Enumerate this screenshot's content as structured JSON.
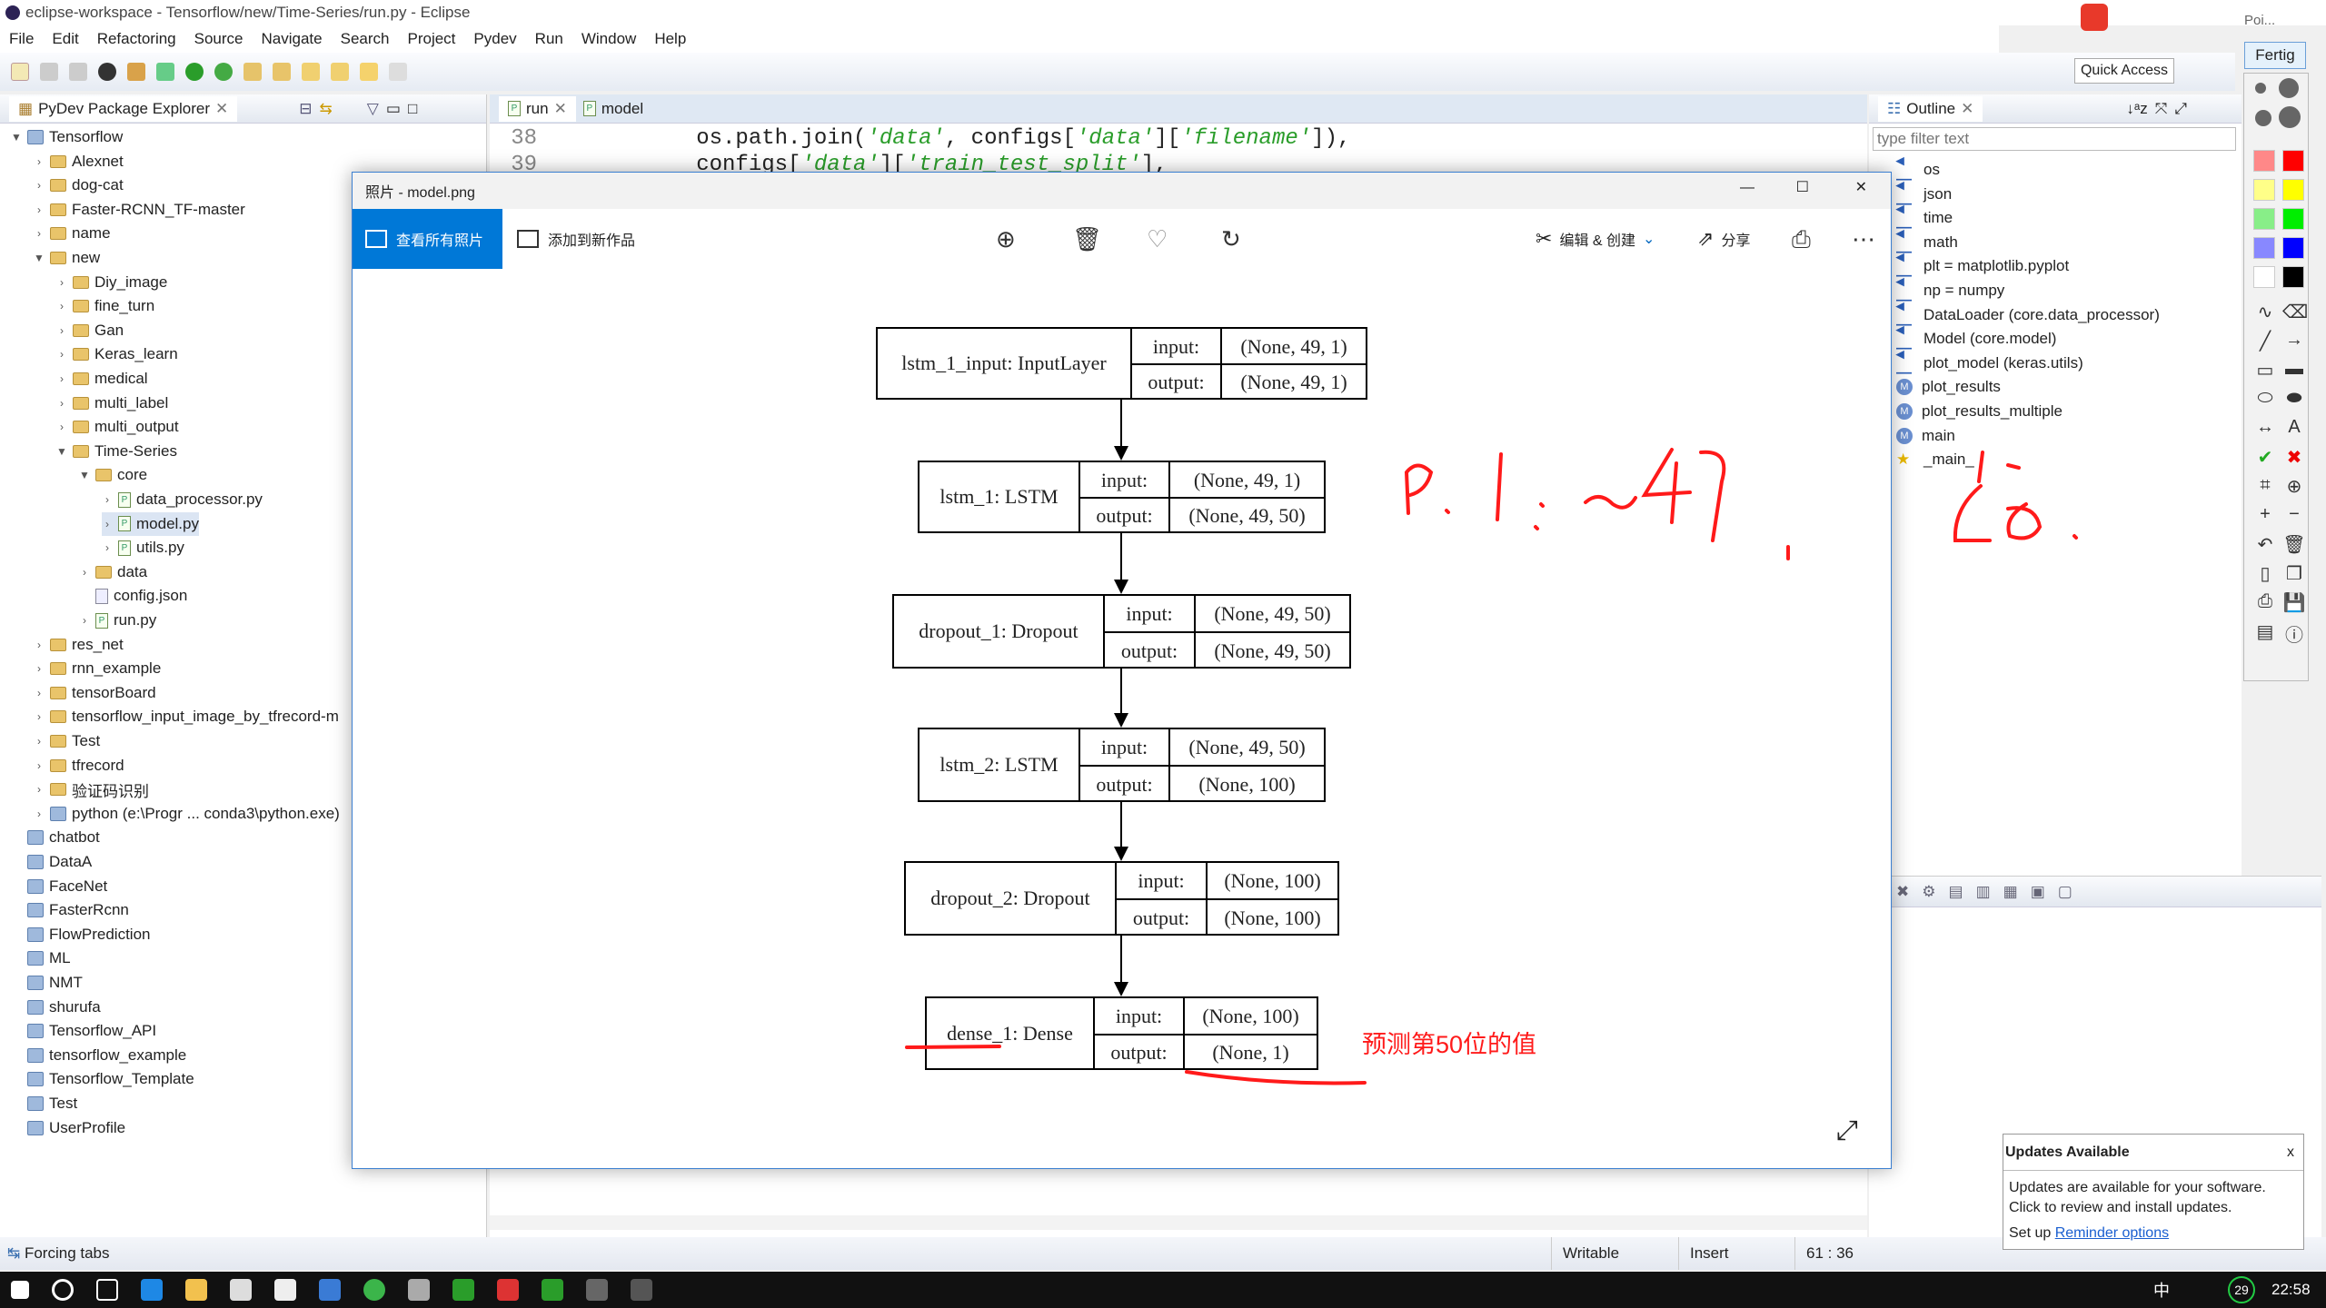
{
  "window": {
    "title": "eclipse-workspace - Tensorflow/new/Time-Series/run.py - Eclipse"
  },
  "menu": [
    "File",
    "Edit",
    "Refactoring",
    "Source",
    "Navigate",
    "Search",
    "Project",
    "Pydev",
    "Run",
    "Window",
    "Help"
  ],
  "quick_access": "Quick Access",
  "fertig": "Fertig",
  "explorer": {
    "title": "PyDev Package Explorer",
    "items": [
      {
        "label": "Tensorflow",
        "level": 0,
        "type": "project",
        "state": "open"
      },
      {
        "label": "Alexnet",
        "level": 1,
        "type": "folder",
        "state": "closed"
      },
      {
        "label": "dog-cat",
        "level": 1,
        "type": "folder",
        "state": "closed"
      },
      {
        "label": "Faster-RCNN_TF-master",
        "level": 1,
        "type": "folder",
        "state": "closed"
      },
      {
        "label": "name",
        "level": 1,
        "type": "folder",
        "state": "closed"
      },
      {
        "label": "new",
        "level": 1,
        "type": "folder",
        "state": "open"
      },
      {
        "label": "Diy_image",
        "level": 2,
        "type": "folder",
        "state": "closed"
      },
      {
        "label": "fine_turn",
        "level": 2,
        "type": "folder",
        "state": "closed"
      },
      {
        "label": "Gan",
        "level": 2,
        "type": "folder",
        "state": "closed"
      },
      {
        "label": "Keras_learn",
        "level": 2,
        "type": "folder",
        "state": "closed"
      },
      {
        "label": "medical",
        "level": 2,
        "type": "folder",
        "state": "closed"
      },
      {
        "label": "multi_label",
        "level": 2,
        "type": "folder",
        "state": "closed"
      },
      {
        "label": "multi_output",
        "level": 2,
        "type": "folder",
        "state": "closed"
      },
      {
        "label": "Time-Series",
        "level": 2,
        "type": "folder",
        "state": "open"
      },
      {
        "label": "core",
        "level": 3,
        "type": "folder",
        "state": "open"
      },
      {
        "label": "data_processor.py",
        "level": 4,
        "type": "py",
        "state": "closed"
      },
      {
        "label": "model.py",
        "level": 4,
        "type": "py",
        "state": "closed",
        "selected": true
      },
      {
        "label": "utils.py",
        "level": 4,
        "type": "py",
        "state": "closed"
      },
      {
        "label": "data",
        "level": 3,
        "type": "folder",
        "state": "closed"
      },
      {
        "label": "config.json",
        "level": 3,
        "type": "json",
        "state": "none"
      },
      {
        "label": "run.py",
        "level": 3,
        "type": "py",
        "state": "closed"
      },
      {
        "label": "res_net",
        "level": 1,
        "type": "folder",
        "state": "closed"
      },
      {
        "label": "rnn_example",
        "level": 1,
        "type": "folder",
        "state": "closed"
      },
      {
        "label": "tensorBoard",
        "level": 1,
        "type": "folder",
        "state": "closed"
      },
      {
        "label": "tensorflow_input_image_by_tfrecord-m",
        "level": 1,
        "type": "folder",
        "state": "closed"
      },
      {
        "label": "Test",
        "level": 1,
        "type": "folder",
        "state": "closed"
      },
      {
        "label": "tfrecord",
        "level": 1,
        "type": "folder",
        "state": "closed"
      },
      {
        "label": "验证码识别",
        "level": 1,
        "type": "folder",
        "state": "closed"
      },
      {
        "label": "python  (e:\\Progr ... conda3\\python.exe)",
        "level": 1,
        "type": "python",
        "state": "closed"
      },
      {
        "label": "chatbot",
        "level": 0,
        "type": "project",
        "state": "none"
      },
      {
        "label": "DataA",
        "level": 0,
        "type": "project",
        "state": "none"
      },
      {
        "label": "FaceNet",
        "level": 0,
        "type": "project",
        "state": "none"
      },
      {
        "label": "FasterRcnn",
        "level": 0,
        "type": "project",
        "state": "none"
      },
      {
        "label": "FlowPrediction",
        "level": 0,
        "type": "project",
        "state": "none"
      },
      {
        "label": "ML",
        "level": 0,
        "type": "project",
        "state": "none"
      },
      {
        "label": "NMT",
        "level": 0,
        "type": "project",
        "state": "none"
      },
      {
        "label": "shurufa",
        "level": 0,
        "type": "project",
        "state": "none"
      },
      {
        "label": "Tensorflow_API",
        "level": 0,
        "type": "project",
        "state": "none"
      },
      {
        "label": "tensorflow_example",
        "level": 0,
        "type": "project",
        "state": "none"
      },
      {
        "label": "Tensorflow_Template",
        "level": 0,
        "type": "project",
        "state": "none"
      },
      {
        "label": "Test",
        "level": 0,
        "type": "project",
        "state": "none"
      },
      {
        "label": "UserProfile",
        "level": 0,
        "type": "project",
        "state": "none"
      }
    ]
  },
  "editor": {
    "tabs": [
      "run",
      "model"
    ],
    "lines": [
      {
        "num": "38",
        "pre": "        os.path.join(",
        "s1": "'data'",
        "mid": ", configs[",
        "s2": "'data'",
        "mid2": "][",
        "s3": "'filename'",
        "post": "]),"
      },
      {
        "num": "39",
        "pre": "        configs[",
        "s1": "'data'",
        "mid": "][",
        "s2": "'train_test_split'",
        "mid2": "],",
        "s3": "",
        "post": ""
      }
    ]
  },
  "outline": {
    "title": "Outline",
    "filter_placeholder": "type filter text",
    "items": [
      {
        "label": "os",
        "kind": "import"
      },
      {
        "label": "json",
        "kind": "import"
      },
      {
        "label": "time",
        "kind": "import"
      },
      {
        "label": "math",
        "kind": "import"
      },
      {
        "label": "plt = matplotlib.pyplot",
        "kind": "import"
      },
      {
        "label": "np = numpy",
        "kind": "import"
      },
      {
        "label": "DataLoader (core.data_processor)",
        "kind": "import"
      },
      {
        "label": "Model (core.model)",
        "kind": "import"
      },
      {
        "label": "plot_model (keras.utils)",
        "kind": "import"
      },
      {
        "label": "plot_results",
        "kind": "method"
      },
      {
        "label": "plot_results_multiple",
        "kind": "method"
      },
      {
        "label": "main",
        "kind": "method"
      },
      {
        "label": "_main_",
        "kind": "main"
      }
    ]
  },
  "photos": {
    "title": "照片 - model.png",
    "all_photos": "查看所有照片",
    "add_to": "添加到新作品",
    "edit_create": "编辑 & 创建",
    "share": "分享",
    "icons": [
      "zoom-in-icon",
      "delete-icon",
      "favorite-icon",
      "rotate-icon",
      "print-icon",
      "more-icon"
    ]
  },
  "model_diagram": {
    "input_label": "input:",
    "output_label": "output:",
    "layers": [
      {
        "name": "lstm_1_input: InputLayer",
        "input": "(None, 49, 1)",
        "output": "(None, 49, 1)"
      },
      {
        "name": "lstm_1: LSTM",
        "input": "(None, 49, 1)",
        "output": "(None, 49, 50)"
      },
      {
        "name": "dropout_1: Dropout",
        "input": "(None, 49, 50)",
        "output": "(None, 49, 50)"
      },
      {
        "name": "lstm_2: LSTM",
        "input": "(None, 49, 50)",
        "output": "(None, 100)"
      },
      {
        "name": "dropout_2: Dropout",
        "input": "(None, 100)",
        "output": "(None, 100)"
      },
      {
        "name": "dense_1: Dense",
        "input": "(None, 100)",
        "output": "(None, 1)"
      }
    ]
  },
  "annotation": {
    "text": "预测第50位的值",
    "color": "#ff1a1a"
  },
  "status": {
    "left": "Forcing tabs",
    "writable": "Writable",
    "insert": "Insert",
    "position": "61 : 36"
  },
  "popup": {
    "title": "Updates Available",
    "close": "x",
    "line1": "Updates are available for your software.",
    "line2": "Click to review and install updates.",
    "setup": "Set up ",
    "link": "Reminder options"
  },
  "taskbar": {
    "time": "22:58",
    "ime": "中",
    "badge": "29"
  },
  "tray": {
    "poi": "Poi..."
  }
}
